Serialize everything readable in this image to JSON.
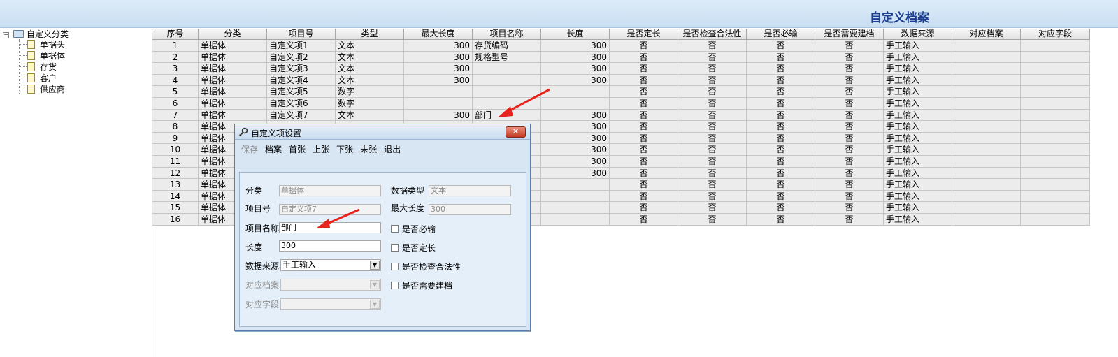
{
  "header": {
    "title": "自定义档案"
  },
  "tree": {
    "toggle": "−",
    "root": "自定义分类",
    "children": [
      "单据头",
      "单据体",
      "存货",
      "客户",
      "供应商"
    ]
  },
  "grid": {
    "columns": [
      "序号",
      "分类",
      "项目号",
      "类型",
      "最大长度",
      "项目名称",
      "长度",
      "是否定长",
      "是否检查合法性",
      "是否必输",
      "是否需要建档",
      "数据来源",
      "对应档案",
      "对应字段"
    ],
    "rows": [
      [
        "1",
        "单据体",
        "自定义项1",
        "文本",
        "300",
        "存货编码",
        "300",
        "否",
        "否",
        "否",
        "否",
        "手工输入",
        "",
        ""
      ],
      [
        "2",
        "单据体",
        "自定义项2",
        "文本",
        "300",
        "规格型号",
        "300",
        "否",
        "否",
        "否",
        "否",
        "手工输入",
        "",
        ""
      ],
      [
        "3",
        "单据体",
        "自定义项3",
        "文本",
        "300",
        "",
        "300",
        "否",
        "否",
        "否",
        "否",
        "手工输入",
        "",
        ""
      ],
      [
        "4",
        "单据体",
        "自定义项4",
        "文本",
        "300",
        "",
        "300",
        "否",
        "否",
        "否",
        "否",
        "手工输入",
        "",
        ""
      ],
      [
        "5",
        "单据体",
        "自定义项5",
        "数字",
        "",
        "",
        "",
        "否",
        "否",
        "否",
        "否",
        "手工输入",
        "",
        ""
      ],
      [
        "6",
        "单据体",
        "自定义项6",
        "数字",
        "",
        "",
        "",
        "否",
        "否",
        "否",
        "否",
        "手工输入",
        "",
        ""
      ],
      [
        "7",
        "单据体",
        "自定义项7",
        "文本",
        "300",
        "部门",
        "300",
        "否",
        "否",
        "否",
        "否",
        "手工输入",
        "",
        ""
      ],
      [
        "8",
        "单据体",
        "",
        "",
        "",
        "",
        "300",
        "否",
        "否",
        "否",
        "否",
        "手工输入",
        "",
        ""
      ],
      [
        "9",
        "单据体",
        "",
        "",
        "",
        "",
        "300",
        "否",
        "否",
        "否",
        "否",
        "手工输入",
        "",
        ""
      ],
      [
        "10",
        "单据体",
        "",
        "",
        "",
        "",
        "300",
        "否",
        "否",
        "否",
        "否",
        "手工输入",
        "",
        ""
      ],
      [
        "11",
        "单据体",
        "",
        "",
        "",
        "",
        "300",
        "否",
        "否",
        "否",
        "否",
        "手工输入",
        "",
        ""
      ],
      [
        "12",
        "单据体",
        "",
        "",
        "",
        "",
        "300",
        "否",
        "否",
        "否",
        "否",
        "手工输入",
        "",
        ""
      ],
      [
        "13",
        "单据体",
        "",
        "",
        "",
        "",
        "",
        "否",
        "否",
        "否",
        "否",
        "手工输入",
        "",
        ""
      ],
      [
        "14",
        "单据体",
        "",
        "",
        "",
        "",
        "",
        "否",
        "否",
        "否",
        "否",
        "手工输入",
        "",
        ""
      ],
      [
        "15",
        "单据体",
        "",
        "",
        "",
        "",
        "",
        "否",
        "否",
        "否",
        "否",
        "手工输入",
        "",
        ""
      ],
      [
        "16",
        "单据体",
        "",
        "",
        "",
        "",
        "",
        "否",
        "否",
        "否",
        "否",
        "手工输入",
        "",
        ""
      ]
    ]
  },
  "dialog": {
    "title": "自定义项设置",
    "close_label": "✕",
    "toolbar": [
      "保存",
      "档案",
      "首张",
      "上张",
      "下张",
      "末张",
      "退出"
    ],
    "fields": {
      "category_label": "分类",
      "category_value": "单据体",
      "datatype_label": "数据类型",
      "datatype_value": "文本",
      "item_no_label": "项目号",
      "item_no_value": "自定义项7",
      "maxlen_label": "最大长度",
      "maxlen_value": "300",
      "item_name_label": "项目名称",
      "item_name_value": "部门",
      "length_label": "长度",
      "length_value": "300",
      "source_label": "数据来源",
      "source_value": "手工输入",
      "archive_label": "对应档案",
      "archive_value": "",
      "field_label": "对应字段",
      "field_value": ""
    },
    "checkboxes": [
      "是否必输",
      "是否定长",
      "是否检查合法性",
      "是否需要建档"
    ]
  },
  "colors": {
    "header_bg": "#dcebf8",
    "title": "#1c3f94",
    "arrow": "#e8231b",
    "dialog_bg": "#d8e6f3"
  }
}
